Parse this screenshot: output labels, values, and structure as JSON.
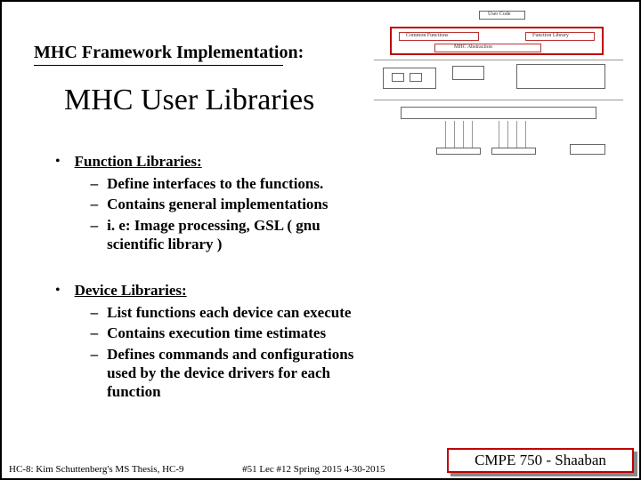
{
  "subtitle": "MHC Framework Implementation:",
  "title": "MHC User Libraries",
  "bullets": [
    {
      "head": "Function Libraries:",
      "subs": [
        "Define interfaces to the functions.",
        "Contains general implementations",
        "i. e: Image processing, GSL ( gnu scientific library )"
      ]
    },
    {
      "head": "Device Libraries:",
      "subs": [
        "List functions each device can execute",
        "Contains execution time estimates",
        "Defines commands and configurations used by the device drivers for each function"
      ]
    }
  ],
  "thumb": {
    "top_label": "User Code",
    "red_left": "Common Functions",
    "red_right": "Function Library",
    "red_sub": "MHC Abstraction"
  },
  "footer": {
    "left": "HC-8: Kim Schuttenberg's MS Thesis, HC-9",
    "mid": "#51  Lec #12  Spring 2015 4-30-2015"
  },
  "badge": "CMPE 750 - Shaaban"
}
